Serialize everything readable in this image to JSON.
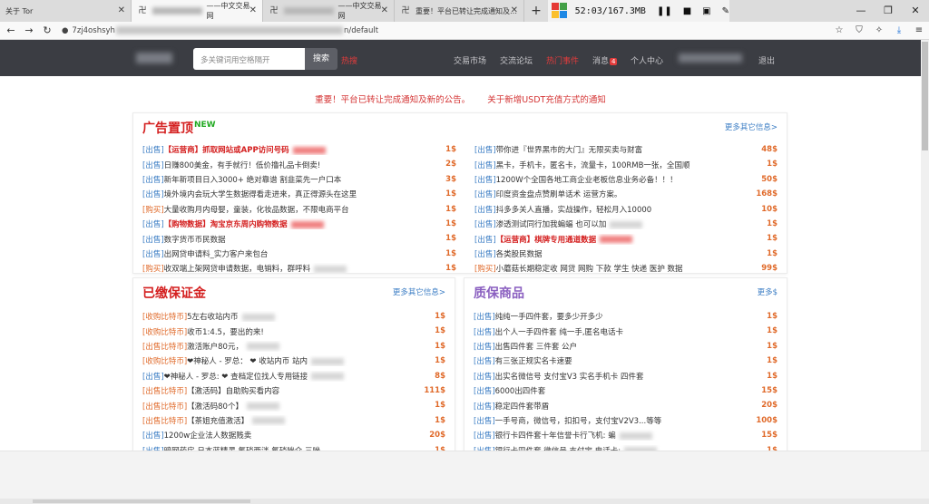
{
  "browser": {
    "tabs": [
      {
        "label": "关于 Tor",
        "icon": "",
        "active": false
      },
      {
        "label": "——中文交易网",
        "icon": "卍",
        "active": true
      },
      {
        "label": "——中文交易网",
        "icon": "卍",
        "active": false
      },
      {
        "label": "重要！平台已转让完成通知及…",
        "icon": "卍",
        "active": false
      }
    ],
    "new_tab": "+",
    "media_time": "52:03/167.3MB",
    "url_prefix": "7zj4oshsyh",
    "url_suffix": "n/default"
  },
  "site": {
    "search_placeholder": "多关键词用空格隔开",
    "search_button": "搜索",
    "hot_label": "热搜",
    "nav": [
      {
        "label": "交易市场",
        "highlight": false
      },
      {
        "label": "交流论坛",
        "highlight": false
      },
      {
        "label": "热门事件",
        "highlight": true
      },
      {
        "label": "消息",
        "highlight": false,
        "badge": "4"
      },
      {
        "label": "个人中心",
        "highlight": false
      }
    ],
    "logout": "退出"
  },
  "notices": [
    "重要！平台已转让完成通知及新的公告。",
    "关于新增USDT充值方式的通知"
  ],
  "panels": {
    "ads": {
      "title": "广告置顶",
      "new_tag": "NEW",
      "more": "更多其它信息>",
      "left": [
        {
          "tag": "[出售]",
          "title": "【运营商】抓取网站或APP访问号码",
          "price": "1$",
          "red": true,
          "blur": true,
          "buy": false
        },
        {
          "tag": "[出售]",
          "title": "日赚800美金，有手就行！低价撸礼品卡倒卖!",
          "price": "2$",
          "red": false,
          "blur": false,
          "buy": false
        },
        {
          "tag": "[出售]",
          "title": "新年新项目日入3000+ 绝对靠谱 割韭菜先一户口本",
          "price": "3$",
          "red": false,
          "blur": false,
          "buy": false
        },
        {
          "tag": "[出售]",
          "title": "境外境内会玩大学生数据得看走进来，真正得源头在这里",
          "price": "1$",
          "red": false,
          "blur": false,
          "buy": false
        },
        {
          "tag": "[购买]",
          "title": "大量收购月内母婴，童装，化妆品数据，不限电商平台",
          "price": "1$",
          "red": false,
          "blur": false,
          "buy": true
        },
        {
          "tag": "[出售]",
          "title": "【购物数据】淘宝京东周内购物数据",
          "price": "1$",
          "red": true,
          "blur": true,
          "buy": false
        },
        {
          "tag": "[出售]",
          "title": "数字货币币民数据",
          "price": "1$",
          "red": false,
          "blur": false,
          "buy": false
        },
        {
          "tag": "[出售]",
          "title": "出网贷申请料_实力客户来包台",
          "price": "1$",
          "red": false,
          "blur": false,
          "buy": false
        },
        {
          "tag": "[购买]",
          "title": "收双端上架网贷申请数据，电销料，群呼料",
          "price": "1$",
          "red": false,
          "blur": true,
          "buy": true
        }
      ],
      "right": [
        {
          "tag": "[出售]",
          "title": "带你进『世界黑市的大门』无限买卖与财富",
          "price": "48$",
          "red": false,
          "blur": false,
          "buy": false
        },
        {
          "tag": "[出售]",
          "title": "黑卡，手机卡，匿名卡，流量卡，100RMB一张，全国顺",
          "price": "1$",
          "red": false,
          "blur": false,
          "buy": false
        },
        {
          "tag": "[出售]",
          "title": "1200W个全国各地工商企业老板信息业务必备！！！",
          "price": "50$",
          "red": false,
          "blur": false,
          "buy": false
        },
        {
          "tag": "[出售]",
          "title": "印度资金盘点赞刷单话术 运营方案。",
          "price": "168$",
          "red": false,
          "blur": false,
          "buy": false
        },
        {
          "tag": "[出售]",
          "title": "抖多多关人直播，实战操作，轻松月入10000",
          "price": "10$",
          "red": false,
          "blur": false,
          "buy": false
        },
        {
          "tag": "[出售]",
          "title": "渗透测试同行加我蝙蝠              也可以加",
          "price": "1$",
          "red": false,
          "blur": true,
          "buy": false
        },
        {
          "tag": "[出售]",
          "title": "【运营商】棋牌专用通道数据",
          "price": "1$",
          "red": true,
          "blur": true,
          "buy": false
        },
        {
          "tag": "[出售]",
          "title": "各类股民数据",
          "price": "1$",
          "red": false,
          "blur": false,
          "buy": false
        },
        {
          "tag": "[购买]",
          "title": "小蘑菇长期稳定收 网贷 网购 下款 学生 快递 医护 数据",
          "price": "99$",
          "red": false,
          "blur": false,
          "buy": true
        }
      ]
    },
    "deposit": {
      "title": "已缴保证金",
      "more": "更多其它信息>",
      "rows": [
        {
          "tag": "[收购比特币]",
          "title": "5左右收站内币",
          "price": "1$",
          "blur": true,
          "buy": true
        },
        {
          "tag": "[收购比特币]",
          "title": "收币1:4.5，要出的来!",
          "price": "1$",
          "blur": false,
          "buy": true
        },
        {
          "tag": "[出售比特币]",
          "title": "激活账户80元，",
          "price": "1$",
          "blur": true,
          "buy": true
        },
        {
          "tag": "[收购比特币]",
          "title": "❤神秘人 - 罗总：                 ❤ 收站内币 站内",
          "price": "1$",
          "blur": true,
          "buy": true
        },
        {
          "tag": "[出售]",
          "title": "❤神秘人 - 罗总:                 ❤ 查档定位找人专用链接",
          "price": "8$",
          "blur": true,
          "buy": false
        },
        {
          "tag": "[出售比特币]",
          "title": "【激活码】自助购买看内容",
          "price": "111$",
          "blur": false,
          "buy": true
        },
        {
          "tag": "[出售比特币]",
          "title": "【激活码80个】",
          "price": "1$",
          "blur": true,
          "buy": true
        },
        {
          "tag": "[出售比特币]",
          "title": "【茶姐充值激活】",
          "price": "1$",
          "blur": true,
          "buy": true
        },
        {
          "tag": "[出售]",
          "title": "1200w企业法人数据贱卖",
          "price": "20$",
          "blur": false,
          "buy": false
        },
        {
          "tag": "[出售]",
          "title": "暗网药房 日本蓝精灵 氟硝西泮 氟硝唑仑 三唑",
          "price": "1$",
          "blur": false,
          "buy": false
        }
      ]
    },
    "quality": {
      "title": "质保商品",
      "more": "更多$",
      "rows": [
        {
          "tag": "[出售]",
          "title": "纯纯一手四件套，要多少开多少",
          "price": "1$",
          "blur": false
        },
        {
          "tag": "[出售]",
          "title": "出个人一手四件套 纯一手,匿名电话卡",
          "price": "1$",
          "blur": false
        },
        {
          "tag": "[出售]",
          "title": "出售四件套 三件套 公户",
          "price": "1$",
          "blur": false
        },
        {
          "tag": "[出售]",
          "title": "有三张正规实名卡速要",
          "price": "1$",
          "blur": false
        },
        {
          "tag": "[出售]",
          "title": "出实名微信号 支付宝V3 实名手机卡 四件套",
          "price": "1$",
          "blur": false
        },
        {
          "tag": "[出售]",
          "title": "6000出四件套",
          "price": "15$",
          "blur": false
        },
        {
          "tag": "[出售]",
          "title": "稳定四件套带盾",
          "price": "20$",
          "blur": false
        },
        {
          "tag": "[出售]",
          "title": "一手号商，微信号，扣扣号，支付宝V2V3...等等",
          "price": "100$",
          "blur": false
        },
        {
          "tag": "[出售]",
          "title": "银行卡四件套十年信誉卡行飞机:                  蝙",
          "price": "15$",
          "blur": true
        },
        {
          "tag": "[出售]",
          "title": "银行卡四件套 微信号 支付宝 电话卡:",
          "price": "1$",
          "blur": true
        }
      ]
    }
  },
  "colors": {
    "header_bg": "#3b3d43",
    "accent_red": "#d42020",
    "link_blue": "#3b7dc4",
    "price_orange": "#e06a2a",
    "purple": "#8a5fc0"
  }
}
